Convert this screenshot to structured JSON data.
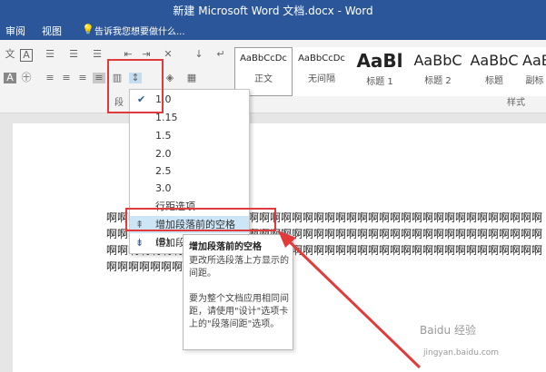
{
  "window": {
    "title": "新建 Microsoft Word 文档.docx - Word"
  },
  "tabs": [
    "审阅",
    "视图"
  ],
  "tell_me": "告诉我您想要做什么...",
  "ribbon": {
    "paragraph_group_label": "段",
    "styles_group_label": "样式",
    "styles": [
      {
        "preview": "AaBbCcDc",
        "name": "正文"
      },
      {
        "preview": "AaBbCcDc",
        "name": "无间隔"
      },
      {
        "preview": "AaBl",
        "name": "标题 1"
      },
      {
        "preview": "AaBbC",
        "name": "标题 2"
      },
      {
        "preview": "AaBbC",
        "name": "标题"
      },
      {
        "preview": "AaBb",
        "name": "副标"
      }
    ]
  },
  "menu": {
    "items": [
      "1.0",
      "1.15",
      "1.5",
      "2.0",
      "2.5",
      "3.0",
      "行距选项...",
      "增加段落前的空格(B)",
      "增加段"
    ]
  },
  "tooltip": {
    "title": "增加段落前的空格",
    "p1": "更改所选段落上方显示的间距。",
    "p2": "要为整个文档应用相同间距，请使用\"设计\"选项卡上的\"段落间距\"选项。"
  },
  "document": {
    "lines": [
      "啊啊啊啊啊啊啊啊啊啊啊啊啊啊啊啊啊啊啊啊啊啊啊啊啊啊啊啊啊啊啊啊啊啊啊啊啊啊啊啊",
      "啊啊啊啊啊啊啊啊啊啊啊啊啊啊啊啊啊啊啊啊啊啊啊啊啊啊啊啊啊啊啊啊啊啊啊啊啊啊啊啊",
      "啊啊啊啊啊啊啊啊啊啊啊啊啊啊啊啊啊啊啊啊啊啊啊啊啊啊啊啊啊啊啊啊啊啊啊啊啊啊啊啊",
      "啊啊啊啊啊啊啊啊啊啊啊啊啊啊"
    ]
  },
  "watermark": {
    "text": "Baidu 经验",
    "url": "jingyan.baidu.com"
  },
  "colors": {
    "ribbon_blue": "#2b579a",
    "highlight": "#cde6f7",
    "annotation_red": "#e23a3a"
  }
}
